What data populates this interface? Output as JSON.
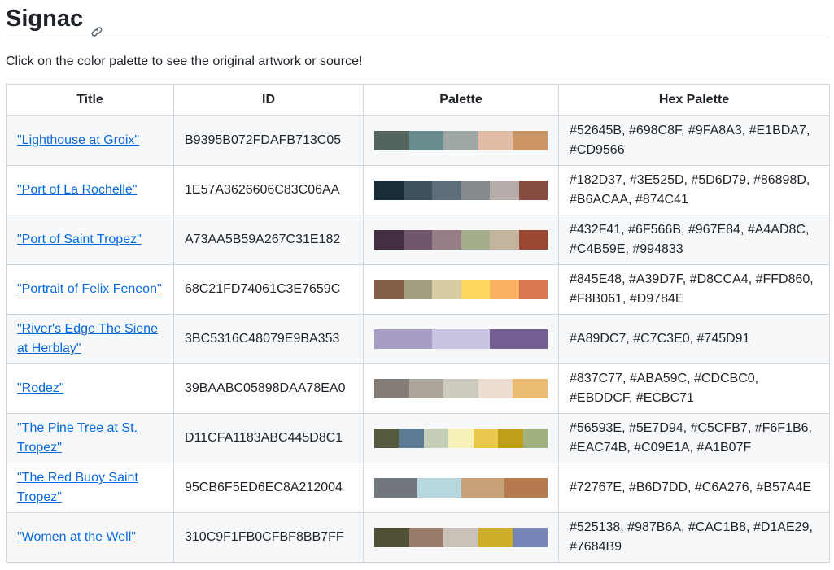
{
  "page": {
    "title": "Signac",
    "intro": "Click on the color palette to see the original artwork or source!"
  },
  "table": {
    "headers": [
      "Title",
      "ID",
      "Palette",
      "Hex Palette"
    ],
    "rows": [
      {
        "title": "\"Lighthouse at Groix\"",
        "id": "B9395B072FDAFB713C05",
        "colors": [
          "#52645B",
          "#698C8F",
          "#9FA8A3",
          "#E1BDA7",
          "#CD9566"
        ],
        "hex": "#52645B, #698C8F, #9FA8A3, #E1BDA7, #CD9566"
      },
      {
        "title": "\"Port of La Rochelle\"",
        "id": "1E57A3626606C83C06AA",
        "colors": [
          "#182D37",
          "#3E525D",
          "#5D6D79",
          "#86898D",
          "#B6ACAA",
          "#874C41"
        ],
        "hex": "#182D37, #3E525D, #5D6D79, #86898D, #B6ACAA, #874C41"
      },
      {
        "title": "\"Port of Saint Tropez\"",
        "id": "A73AA5B59A267C31E182",
        "colors": [
          "#432F41",
          "#6F566B",
          "#967E84",
          "#A4AD8C",
          "#C4B59E",
          "#994833"
        ],
        "hex": "#432F41, #6F566B, #967E84, #A4AD8C, #C4B59E, #994833"
      },
      {
        "title": "\"Portrait of Felix Feneon\"",
        "id": "68C21FD74061C3E7659C",
        "colors": [
          "#845E48",
          "#A39D7F",
          "#D8CCA4",
          "#FFD860",
          "#F8B061",
          "#D9784E"
        ],
        "hex": "#845E48, #A39D7F, #D8CCA4, #FFD860, #F8B061, #D9784E"
      },
      {
        "title": "\"River's Edge The Siene at Herblay\"",
        "id": "3BC5316C48079E9BA353",
        "colors": [
          "#A89DC7",
          "#C7C3E0",
          "#745D91"
        ],
        "hex": "#A89DC7, #C7C3E0, #745D91"
      },
      {
        "title": "\"Rodez\"",
        "id": "39BAABC05898DAA78EA0",
        "colors": [
          "#837C77",
          "#ABA59C",
          "#CDCBC0",
          "#EBDDCF",
          "#ECBC71"
        ],
        "hex": "#837C77, #ABA59C, #CDCBC0, #EBDDCF, #ECBC71"
      },
      {
        "title": "\"The Pine Tree at St. Tropez\"",
        "id": "D11CFA1183ABC445D8C1",
        "colors": [
          "#56593E",
          "#5E7D94",
          "#C5CFB7",
          "#F6F1B6",
          "#EAC74B",
          "#C09E1A",
          "#A1B07F"
        ],
        "hex": "#56593E, #5E7D94, #C5CFB7, #F6F1B6, #EAC74B, #C09E1A, #A1B07F"
      },
      {
        "title": "\"The Red Buoy Saint Tropez\"",
        "id": "95CB6F5ED6EC8A212004",
        "colors": [
          "#72767E",
          "#B6D7DD",
          "#C6A276",
          "#B57A4E"
        ],
        "hex": "#72767E, #B6D7DD, #C6A276, #B57A4E"
      },
      {
        "title": "\"Women at the Well\"",
        "id": "310C9F1FB0CFBF8BB7FF",
        "colors": [
          "#525138",
          "#987B6A",
          "#CAC1B8",
          "#D1AE29",
          "#7684B9"
        ],
        "hex": "#525138, #987B6A, #CAC1B8, #D1AE29, #7684B9"
      }
    ]
  }
}
